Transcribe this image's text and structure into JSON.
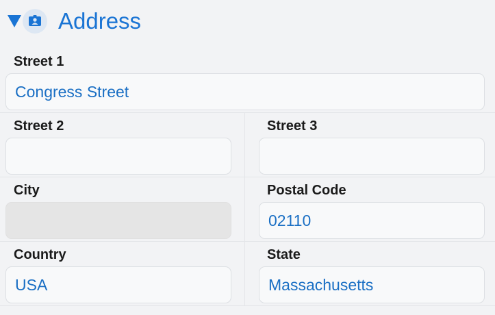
{
  "section": {
    "title": "Address",
    "toggle_icon": "caret-down-icon",
    "section_icon": "address-card-icon",
    "accent_color": "#1a74d4"
  },
  "fields": {
    "street1": {
      "label": "Street 1",
      "value": "Congress Street",
      "placeholder": ""
    },
    "street2": {
      "label": "Street 2",
      "value": "",
      "placeholder": ""
    },
    "street3": {
      "label": "Street 3",
      "value": "",
      "placeholder": ""
    },
    "city": {
      "label": "City",
      "value": "",
      "placeholder": "",
      "disabled": true
    },
    "postal_code": {
      "label": "Postal Code",
      "value": "02110",
      "placeholder": ""
    },
    "country": {
      "label": "Country",
      "value": "USA",
      "placeholder": ""
    },
    "state": {
      "label": "State",
      "value": "Massachusetts",
      "placeholder": ""
    }
  }
}
